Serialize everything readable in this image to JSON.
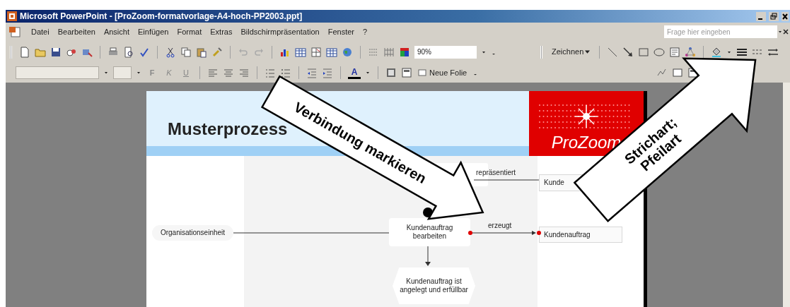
{
  "window": {
    "title": "Microsoft PowerPoint - [ProZoom-formatvorlage-A4-hoch-PP2003.ppt]"
  },
  "menu": [
    "Datei",
    "Bearbeiten",
    "Ansicht",
    "Einfügen",
    "Format",
    "Extras",
    "Bildschirmpräsentation",
    "Fenster",
    "?"
  ],
  "help_field": {
    "placeholder": "Frage hier eingeben"
  },
  "standard_toolbar": {
    "zoom": "90%"
  },
  "drawing_toolbar": {
    "draw_menu": "Zeichnen"
  },
  "formatting_toolbar": {
    "bold": "F",
    "italic": "K",
    "underline": "U",
    "font_color": "A",
    "new_slide": "Neue Folie"
  },
  "slide": {
    "title": "Musterprozess",
    "logo": "ProZoom",
    "nodes": [
      {
        "kind": "oval",
        "label": "Organisationseinheit"
      },
      {
        "kind": "function",
        "label": "Kundenauftrag bearbeiten"
      },
      {
        "kind": "info",
        "label": "Kunde"
      },
      {
        "kind": "info",
        "label": "Kundenauftrag"
      },
      {
        "kind": "event",
        "label": "Kundenauftrag ist angelegt und erfüllbar"
      }
    ],
    "edges": [
      {
        "label": "repräsentiert",
        "selected": false
      },
      {
        "label": "erzeugt",
        "selected": true
      }
    ]
  },
  "callouts": [
    {
      "lines": [
        "Verbindung markieren"
      ]
    },
    {
      "lines": [
        "Strichart;",
        "Pfeilart"
      ]
    }
  ]
}
